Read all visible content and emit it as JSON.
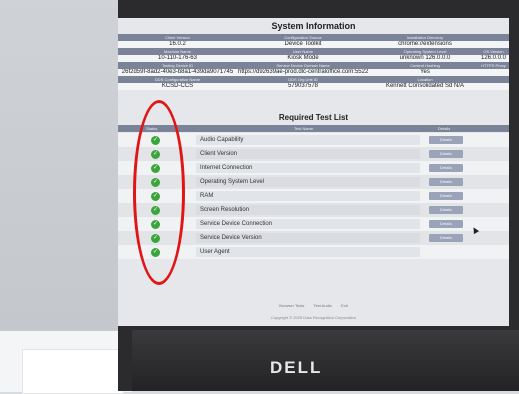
{
  "window": {
    "title": "System Information"
  },
  "brand": "DELL",
  "system_info": {
    "rows": [
      {
        "headers": [
          "Client Version",
          "Configuration Source",
          "Installation Directory",
          ""
        ],
        "values": [
          "16.0.2",
          "Device Toolkit",
          "chrome://extensions",
          ""
        ]
      },
      {
        "headers": [
          "Machine Name",
          "User Name",
          "Operating System Level",
          "OS Version"
        ],
        "values": [
          "10-110-176-63",
          "Kiosk Mode",
          "unknown 126.0.0.0",
          "126.0.0.0"
        ]
      },
      {
        "headers": [
          "Testing Device ID",
          "Service Device Domain Name",
          "Content Hashing",
          "HTTPS Proxy"
        ],
        "values": [
          "26f2d59f-8ad2-40e3-b8a1-439da9071745",
          "https://d92639ae-prod.dlc-centraloffice.com:55222/",
          "Yes",
          ""
        ]
      },
      {
        "headers": [
          "DDS Configuration Name",
          "DDS Org Unit ID",
          "Location",
          ""
        ],
        "values": [
          "KCSD-CCS",
          "579037578",
          "Kennett Consolidated Sd N/A",
          ""
        ]
      }
    ]
  },
  "required_tests": {
    "title": "Required Test List",
    "headers": {
      "status": "Status",
      "test_name": "Test Name",
      "details": "Details"
    },
    "items": [
      {
        "name": "Audio Capability",
        "status": "pass",
        "details_label": "Details"
      },
      {
        "name": "Client Version",
        "status": "pass",
        "details_label": "Details"
      },
      {
        "name": "Internet Connection",
        "status": "pass",
        "details_label": "Details"
      },
      {
        "name": "Operating System Level",
        "status": "pass",
        "details_label": "Details"
      },
      {
        "name": "RAM",
        "status": "pass",
        "details_label": "Details"
      },
      {
        "name": "Screen Resolution",
        "status": "pass",
        "details_label": "Details"
      },
      {
        "name": "Service Device Connection",
        "status": "pass",
        "details_label": "Details"
      },
      {
        "name": "Service Device Version",
        "status": "pass",
        "details_label": "Details"
      },
      {
        "name": "User Agent",
        "status": "pass",
        "details_label": "Details"
      }
    ]
  },
  "footer": {
    "links": [
      "Browser Tests",
      "Test Audio",
      "Exit"
    ],
    "copyright": "Copyright © 2025 Data Recognition Corporation"
  },
  "colors": {
    "header_bg": "#7b8398",
    "check_green": "#3aa53a",
    "annotation_red": "#e01515"
  }
}
